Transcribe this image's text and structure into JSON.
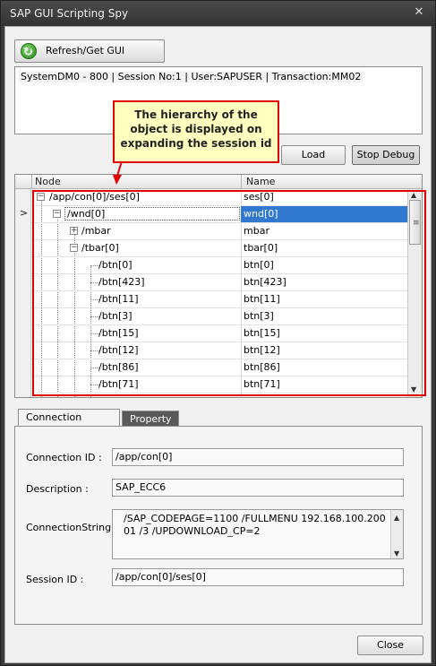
{
  "window": {
    "title": "SAP GUI Scripting Spy",
    "close_glyph": "✕"
  },
  "toolbar": {
    "refresh_label": "Refresh/Get GUI Session"
  },
  "session": {
    "info": "SystemDM0 - 800 | Session No:1 | User:SAPUSER | Transaction:MM02"
  },
  "callout": {
    "text": "The hierarchy of the object is displayed on expanding the session id"
  },
  "buttons": {
    "load": "Load",
    "stop_debug": "Stop Debug",
    "close": "Close"
  },
  "grid": {
    "columns": {
      "node": "Node",
      "name": "Name"
    },
    "current_row_marker": ">",
    "rows": [
      {
        "node": "/app/con[0]/ses[0]",
        "name": "ses[0]"
      },
      {
        "node": "/wnd[0]",
        "name": "wnd[0]"
      },
      {
        "node": "/mbar",
        "name": "mbar"
      },
      {
        "node": "/tbar[0]",
        "name": "tbar[0]"
      },
      {
        "node": "/btn[0]",
        "name": "btn[0]"
      },
      {
        "node": "/btn[423]",
        "name": "btn[423]"
      },
      {
        "node": "/btn[11]",
        "name": "btn[11]"
      },
      {
        "node": "/btn[3]",
        "name": "btn[3]"
      },
      {
        "node": "/btn[15]",
        "name": "btn[15]"
      },
      {
        "node": "/btn[12]",
        "name": "btn[12]"
      },
      {
        "node": "/btn[86]",
        "name": "btn[86]"
      },
      {
        "node": "/btn[71]",
        "name": "btn[71]"
      }
    ]
  },
  "tabs": {
    "connection": "Connection Property",
    "property": "Property"
  },
  "props": {
    "connection_id_label": "Connection ID :",
    "connection_id": "/app/con[0]",
    "description_label": "Description :",
    "description": "SAP_ECC6",
    "connstring_label": "ConnectionString :",
    "connstring": "/SAP_CODEPAGE=1100  /FULLMENU  192.168.100.200 01 /3 /UPDOWNLOAD_CP=2",
    "session_id_label": "Session ID :",
    "session_id": "/app/con[0]/ses[0]"
  }
}
